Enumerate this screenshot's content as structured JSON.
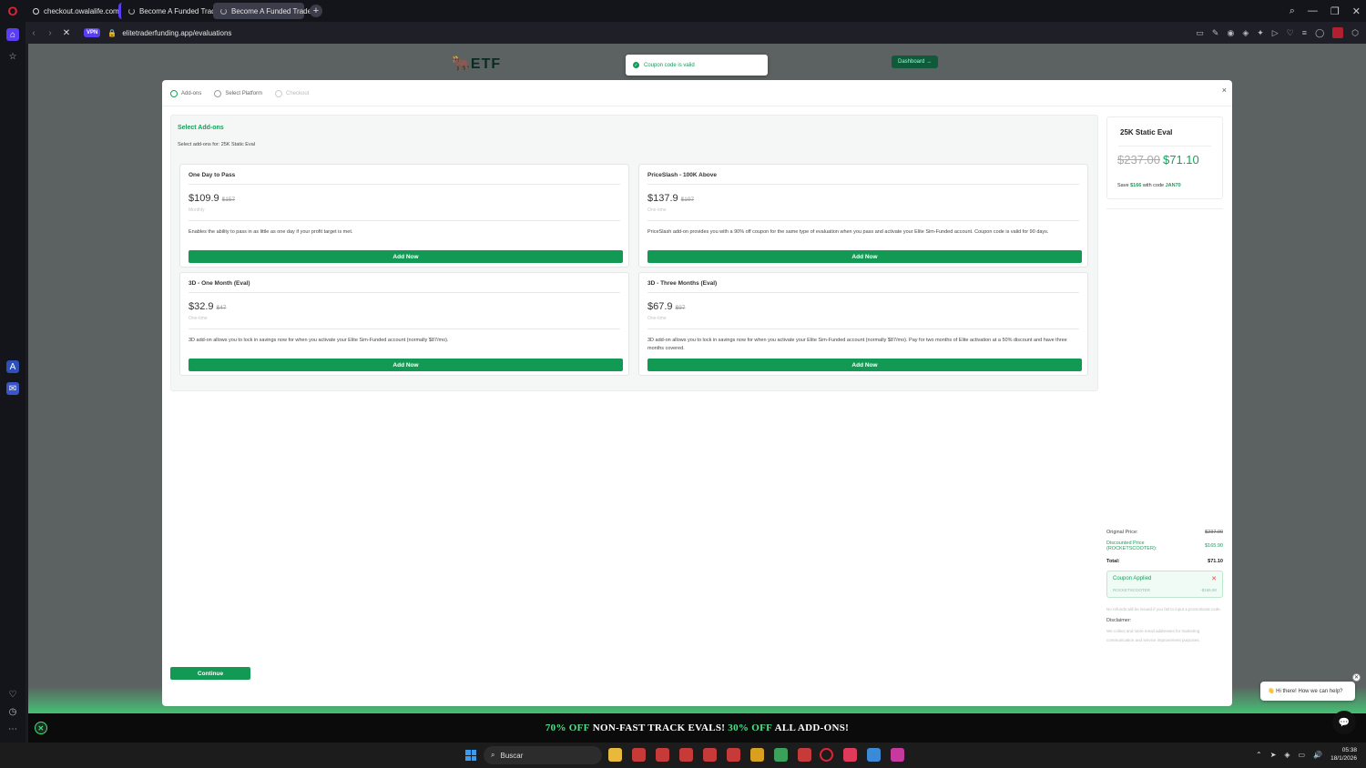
{
  "browser": {
    "tabs": [
      {
        "label": "checkout.owalalife.com"
      },
      {
        "label": "Become A Funded Trader"
      },
      {
        "label": "Become A Funded Trader"
      }
    ],
    "vpn_label": "VPN",
    "url": "elitetraderfunding.app/evaluations"
  },
  "page": {
    "logo_text": "ETF",
    "dashboard_label": "Dashboard →",
    "toast": "Coupon code is valid",
    "promo": {
      "part1": "70% OFF",
      "part2": " NON-FAST TRACK EVALS! ",
      "part3": "30% OFF",
      "part4": " ALL ADD-ONS!"
    },
    "chat_bubble": "👋 Hi there! How we can help?"
  },
  "modal": {
    "close_label": "×",
    "steps": [
      {
        "label": "Add-ons"
      },
      {
        "label": "Select Platform"
      },
      {
        "label": "Checkout"
      }
    ],
    "section_title": "Select Add-ons",
    "section_subtitle": "Select add-ons for: 25K Static Eval",
    "addons": [
      {
        "title": "One Day to Pass",
        "price": "$109.9",
        "old_price": "$157",
        "period": "Monthly",
        "description": "Enables the ability to pass in as little as one day if your profit target is met.",
        "button": "Add Now"
      },
      {
        "title": "PriceSlash - 100K Above",
        "price": "$137.9",
        "old_price": "$197",
        "period": "One-time",
        "description": "PriceSlash add-on provides you with a 90% off coupon for the same type of evaluation when you pass and activate your Elite Sim-Funded account. Coupon code is valid for 90 days.",
        "button": "Add Now"
      },
      {
        "title": "3D - One Month (Eval)",
        "price": "$32.9",
        "old_price": "$47",
        "period": "One-time",
        "description": "3D add-on allows you to lock in savings now for when you activate your Elite Sim-Funded account (normally $87/mo).",
        "button": "Add Now"
      },
      {
        "title": "3D - Three Months (Eval)",
        "price": "$67.9",
        "old_price": "$97",
        "period": "One-time",
        "description": "3D add-on allows you to lock in savings now for when you activate your Elite Sim-Funded account (normally $87/mo). Pay for two months of Elite activation at a 50% discount and have three months covered.",
        "button": "Add Now"
      }
    ],
    "summary": {
      "title": "25K Static Eval",
      "old_price": "$237.00",
      "new_price": "$71.10",
      "save_prefix": "Save ",
      "save_amount": "$166",
      "save_mid": " with code ",
      "save_code": "JAN70"
    },
    "totals": {
      "original_label": "Original Price:",
      "original_value": "$237.00",
      "discount_label": "Discounted Price (ROCKETSCOOTER):",
      "discount_value": "$165.90",
      "total_label": "Total:",
      "total_value": "$71.10",
      "coupon_title": "Coupon Applied",
      "coupon_code": "ROCKETSCOOTER",
      "coupon_amount": "-$165.90",
      "note": "No refunds will be issued if you fail to input a promotional code.",
      "disclaimer_label": "Disclaimer:",
      "disclaimer_text": "We collect and store email addresses for marketing communication and service improvement purposes."
    },
    "continue_label": "Continue"
  },
  "taskbar": {
    "search_placeholder": "Buscar",
    "time": "05:38",
    "date": "18/1/2026"
  },
  "colors": {
    "brand_green": "#129a55",
    "accent_purple": "#5b3df5",
    "promo_green": "#4ee08a"
  }
}
